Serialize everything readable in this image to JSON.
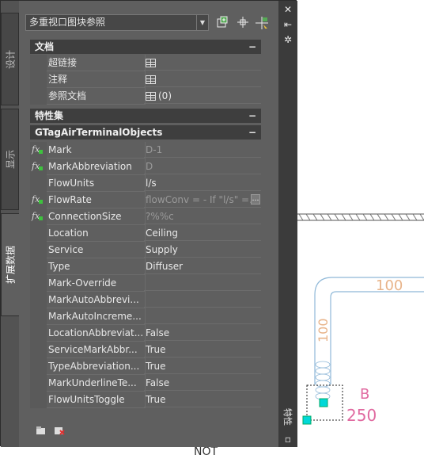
{
  "selector": {
    "value": "多重视口图块参照"
  },
  "tabs": [
    {
      "label": "设计"
    },
    {
      "label": "显示"
    },
    {
      "label": "扩展数据"
    }
  ],
  "titlebar": {
    "side_label": "特性"
  },
  "sections": {
    "doc": {
      "title": "文档",
      "collapse": "−"
    },
    "propset": {
      "title": "特性集",
      "collapse": "−"
    },
    "gtag": {
      "title": "GTagAirTerminalObjects",
      "collapse": "−"
    }
  },
  "doc_rows": [
    {
      "name": "超链接",
      "value": ""
    },
    {
      "name": "注释",
      "value": ""
    },
    {
      "name": "参照文档",
      "value": "(0)"
    }
  ],
  "props": [
    {
      "name": "Mark",
      "value": "D-1",
      "fx": true,
      "dim": true
    },
    {
      "name": "MarkAbbreviation",
      "value": "D",
      "fx": true,
      "dim": true
    },
    {
      "name": "FlowUnits",
      "value": "l/s",
      "fx": false,
      "dim": false
    },
    {
      "name": "FlowRate",
      "value": "flowConv = - If \"l/s\" =...",
      "fx": true,
      "dim": true
    },
    {
      "name": "ConnectionSize",
      "value": "?%%c",
      "fx": true,
      "dim": true
    },
    {
      "name": "Location",
      "value": "Ceiling",
      "fx": false,
      "dim": false
    },
    {
      "name": "Service",
      "value": "Supply",
      "fx": false,
      "dim": false
    },
    {
      "name": "Type",
      "value": "Diffuser",
      "fx": false,
      "dim": false
    },
    {
      "name": "Mark-Override",
      "value": "",
      "fx": false,
      "dim": false
    },
    {
      "name": "MarkAutoAbbrevi...",
      "value": "",
      "fx": false,
      "dim": false
    },
    {
      "name": "MarkAutoIncreme...",
      "value": "",
      "fx": false,
      "dim": false
    },
    {
      "name": "LocationAbbreviat...",
      "value": "False",
      "fx": false,
      "dim": false
    },
    {
      "name": "ServiceMarkAbbr...",
      "value": "True",
      "fx": false,
      "dim": false
    },
    {
      "name": "TypeAbbreviation...",
      "value": "True",
      "fx": false,
      "dim": false
    },
    {
      "name": "MarkUnderlineTe...",
      "value": "False",
      "fx": false,
      "dim": false
    },
    {
      "name": "FlowUnitsToggle",
      "value": "True",
      "fx": false,
      "dim": false
    }
  ],
  "cad": {
    "duct_label_h": "100",
    "duct_label_v": "100",
    "tag_letter": "B",
    "tag_number": "250",
    "bottom_text": "NOT"
  },
  "colors": {
    "duct": "#8fb8d8",
    "label": "#e8b48a",
    "tag": "#e06aa0",
    "grip": "#00d8d8"
  }
}
